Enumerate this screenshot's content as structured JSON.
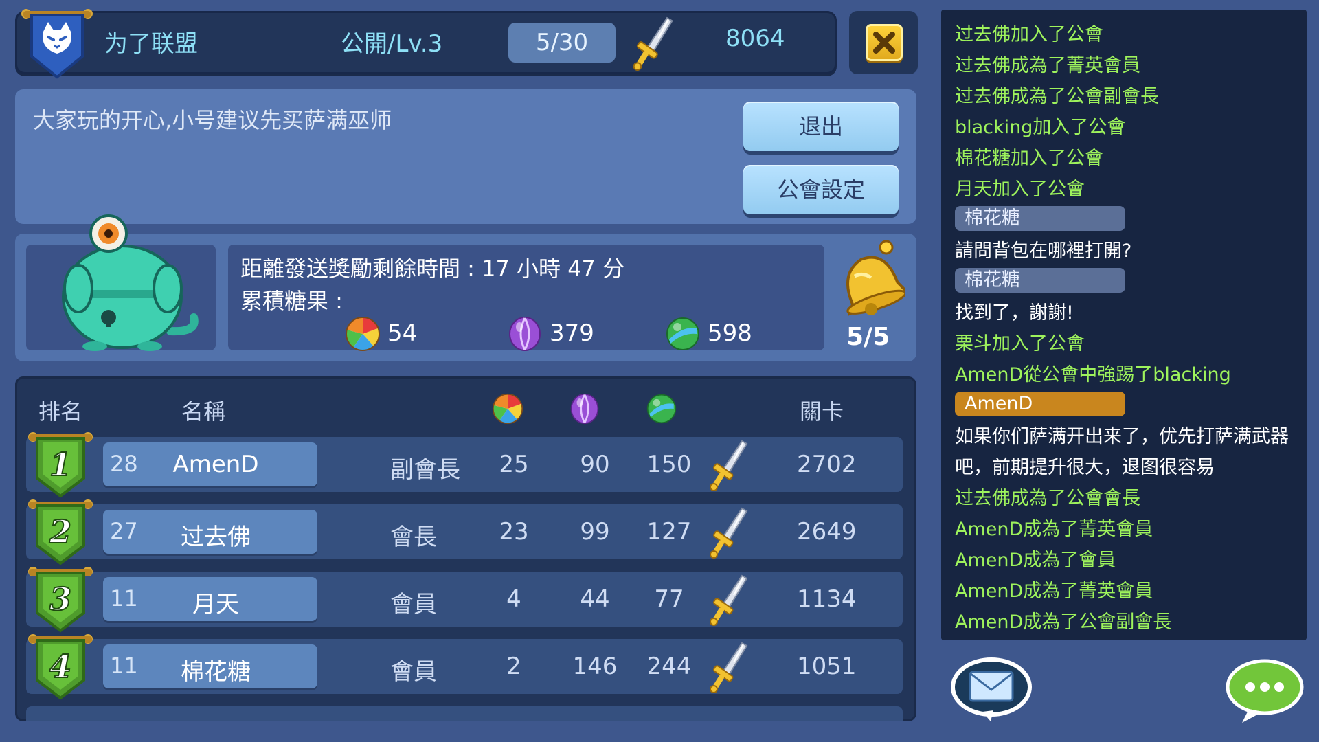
{
  "header": {
    "guild_name": "为了联盟",
    "guild_level": "公開/Lv.3",
    "member_count": "5/30",
    "power": "8064"
  },
  "description": {
    "text": "大家玩的开心,小号建议先买萨满巫师",
    "exit_label": "退出",
    "settings_label": "公會設定"
  },
  "reward": {
    "time_text": "距離發送獎勵剩餘時間 : 17 小時 47 分",
    "candies_label": "累積糖果 :",
    "candy_a": "54",
    "candy_b": "379",
    "candy_c": "598",
    "bell_count": "5/5"
  },
  "table": {
    "headers": {
      "rank": "排名",
      "name": "名稱",
      "stage": "關卡"
    },
    "rows": [
      {
        "rank": "1",
        "level": "28",
        "name": "AmenD",
        "role": "副會長",
        "candy_a": "25",
        "candy_b": "90",
        "candy_c": "150",
        "stage": "2702"
      },
      {
        "rank": "2",
        "level": "27",
        "name": "过去佛",
        "role": "會長",
        "candy_a": "23",
        "candy_b": "99",
        "candy_c": "127",
        "stage": "2649"
      },
      {
        "rank": "3",
        "level": "11",
        "name": "月天",
        "role": "會員",
        "candy_a": "4",
        "candy_b": "44",
        "candy_c": "77",
        "stage": "1134"
      },
      {
        "rank": "4",
        "level": "11",
        "name": "棉花糖",
        "role": "會員",
        "candy_a": "2",
        "candy_b": "146",
        "candy_c": "244",
        "stage": "1051"
      }
    ]
  },
  "chat": {
    "messages": [
      "过去佛加入了公會",
      "过去佛成為了菁英會員",
      "过去佛成為了公會副會長",
      "blacking加入了公會",
      "棉花糖加入了公會",
      "月天加入了公會",
      "棉花糖",
      "請問背包在哪裡打開?",
      "棉花糖",
      "找到了，謝謝!",
      "栗斗加入了公會",
      "AmenD從公會中強踢了blacking",
      "AmenD",
      "如果你们萨满开出来了，优先打萨满武器",
      "吧，前期提升很大，退图很容易",
      "过去佛成為了公會會長",
      "AmenD成為了菁英會員",
      "AmenD成為了會員",
      "AmenD成為了菁英會員",
      "AmenD成為了公會副會長"
    ]
  },
  "colors": {
    "background": "#3e578d",
    "chat_system": "#9ef35c",
    "chat_user": "#ffffff",
    "accent_gold": "#f2c230"
  },
  "icons": [
    "guild-emblem-icon",
    "sword-icon",
    "close-icon",
    "mascot-icon",
    "candy-swirl-icon",
    "candy-purple-icon",
    "candy-green-icon",
    "bell-icon",
    "rank-badge-icon",
    "mail-icon",
    "chat-bubble-icon"
  ]
}
